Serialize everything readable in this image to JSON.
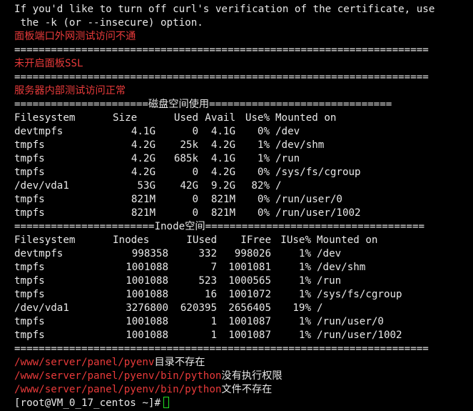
{
  "warning": {
    "line1": "If you'd like to turn off curl's verification of the certificate, use",
    "line2": " the -k (or --insecure) option."
  },
  "messages": {
    "panel_port": "面板端口外网测试访问不通",
    "ssl": "未开启面板SSL",
    "internal": "服务器内部测试访问正常"
  },
  "separators": {
    "plain": "====================================================================",
    "disk_left": "======================",
    "disk_title": "磁盘空间使用",
    "disk_right": "==============================",
    "inode_left": "=======================",
    "inode_title": "Inode空间",
    "inode_right": "===================================="
  },
  "disk": {
    "headers": [
      "Filesystem",
      "Size",
      "Used",
      "Avail",
      "Use%",
      "Mounted on"
    ],
    "rows": [
      [
        "devtmpfs",
        "4.1G",
        "0",
        "4.1G",
        "0%",
        "/dev"
      ],
      [
        "tmpfs",
        "4.2G",
        "25k",
        "4.2G",
        "1%",
        "/dev/shm"
      ],
      [
        "tmpfs",
        "4.2G",
        "685k",
        "4.1G",
        "1%",
        "/run"
      ],
      [
        "tmpfs",
        "4.2G",
        "0",
        "4.2G",
        "0%",
        "/sys/fs/cgroup"
      ],
      [
        "/dev/vda1",
        "53G",
        "42G",
        "9.2G",
        "82%",
        "/"
      ],
      [
        "tmpfs",
        "821M",
        "0",
        "821M",
        "0%",
        "/run/user/0"
      ],
      [
        "tmpfs",
        "821M",
        "0",
        "821M",
        "0%",
        "/run/user/1002"
      ]
    ]
  },
  "inode": {
    "headers": [
      "Filesystem",
      "Inodes",
      "IUsed",
      "IFree",
      "IUse%",
      "Mounted on"
    ],
    "rows": [
      [
        "devtmpfs",
        "998358",
        "332",
        "998026",
        "1%",
        "/dev"
      ],
      [
        "tmpfs",
        "1001088",
        "7",
        "1001081",
        "1%",
        "/dev/shm"
      ],
      [
        "tmpfs",
        "1001088",
        "523",
        "1000565",
        "1%",
        "/run"
      ],
      [
        "tmpfs",
        "1001088",
        "16",
        "1001072",
        "1%",
        "/sys/fs/cgroup"
      ],
      [
        "/dev/vda1",
        "3276800",
        "620395",
        "2656405",
        "19%",
        "/"
      ],
      [
        "tmpfs",
        "1001088",
        "1",
        "1001087",
        "1%",
        "/run/user/0"
      ],
      [
        "tmpfs",
        "1001088",
        "1",
        "1001087",
        "1%",
        "/run/user/1002"
      ]
    ]
  },
  "pyenv": [
    {
      "path": "/www/server/panel/pyenv",
      "status": "目录不存在"
    },
    {
      "path": "/www/server/panel/pyenv/bin/python",
      "status": "没有执行权限"
    },
    {
      "path": "/www/server/panel/pyenv/bin/python",
      "status": "文件不存在"
    }
  ],
  "prompt": "[root@VM_0_17_centos ~]#",
  "colors": {
    "background": "#000000",
    "text": "#e8e8e8",
    "error": "#e83a3a",
    "cursor": "#22e022"
  }
}
